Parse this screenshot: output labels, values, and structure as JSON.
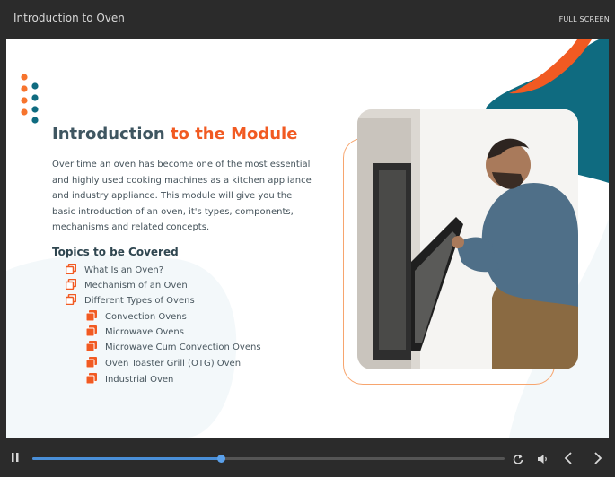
{
  "window": {
    "title": "Introduction to Oven",
    "fullscreen_label": "FULL SCREEN"
  },
  "slide": {
    "heading_part1": "Introduction ",
    "heading_part2": "to the Module",
    "intro_text": "Over time an oven has become one of the most essential and highly used cooking machines as a kitchen appliance and industry appliance. This module will give you the basic introduction of an oven, it's types, components, mechanisms and related concepts.",
    "topics_heading": "Topics to be Covered",
    "topics": [
      {
        "label": "What Is an Oven?"
      },
      {
        "label": "Mechanism of an Oven"
      },
      {
        "label": "Different Types of Ovens"
      }
    ],
    "subtopics": [
      {
        "label": "Convection Ovens"
      },
      {
        "label": "Microwave Ovens"
      },
      {
        "label": "Microwave Cum Convection Ovens"
      },
      {
        "label": "Oven Toaster Grill (OTG) Oven"
      },
      {
        "label": "Industrial Oven"
      }
    ]
  },
  "player": {
    "progress": 0.4,
    "icons": [
      "pause-icon",
      "replay-icon",
      "volume-icon",
      "previous-icon",
      "next-icon"
    ]
  },
  "colors": {
    "accent": "#f15a22",
    "teal": "#0f6b80",
    "heading": "#3f5661",
    "progress": "#4a8fd8"
  }
}
